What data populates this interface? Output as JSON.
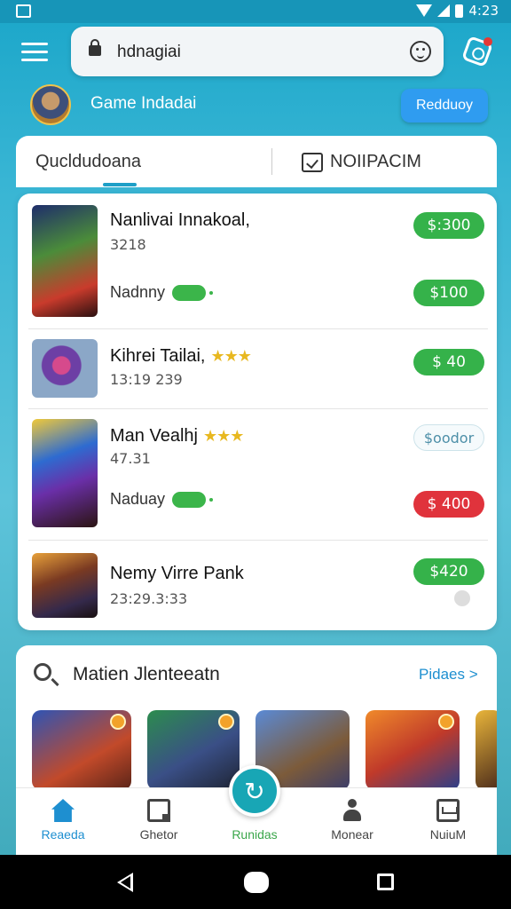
{
  "status_bar": {
    "time": "4:23"
  },
  "header": {
    "search_text": "hdnagiai",
    "username": "Game Indadai",
    "cta_label": "Redduoy"
  },
  "tabs": [
    {
      "label": "Qucldudoana"
    },
    {
      "label": "NOIIPACIM"
    }
  ],
  "games": [
    {
      "title": "Nanlivai  Innakoal,",
      "sub": "3218",
      "meta": "Nadnny",
      "stars": "",
      "price": "$:300",
      "price2": "$100",
      "price2_style": "green"
    },
    {
      "title": "Kihrei Tailai,",
      "sub": "13:19 239",
      "meta": "",
      "stars": "★★★",
      "price": "$ 40",
      "price2": "",
      "price2_style": ""
    },
    {
      "title": "Man Vealhj",
      "sub": "47.31",
      "meta": "Naduay",
      "stars": "★★★",
      "price": "$oodor",
      "price2": "$ 400",
      "price2_style": "red"
    },
    {
      "title": "Nemy Virre Pank",
      "sub": "23:29.3:33",
      "meta": "",
      "stars": "",
      "price": "$420",
      "price2": "",
      "price2_style": ""
    }
  ],
  "featured": {
    "title": "Matien Jlenteeatn",
    "link": "Pidaes >"
  },
  "bottom_nav": [
    {
      "label": "Reaeda",
      "icon": "home-icon"
    },
    {
      "label": "Ghetor",
      "icon": "document-icon"
    },
    {
      "label": "Runidas",
      "icon": "refresh-icon"
    },
    {
      "label": "Monear",
      "icon": "person-icon"
    },
    {
      "label": "NuiuM",
      "icon": "inbox-icon"
    }
  ],
  "colors": {
    "accent": "#1e8fd0",
    "price_green": "#35b24a",
    "price_red": "#e0333c",
    "header_bg": "#1aa6c9"
  }
}
